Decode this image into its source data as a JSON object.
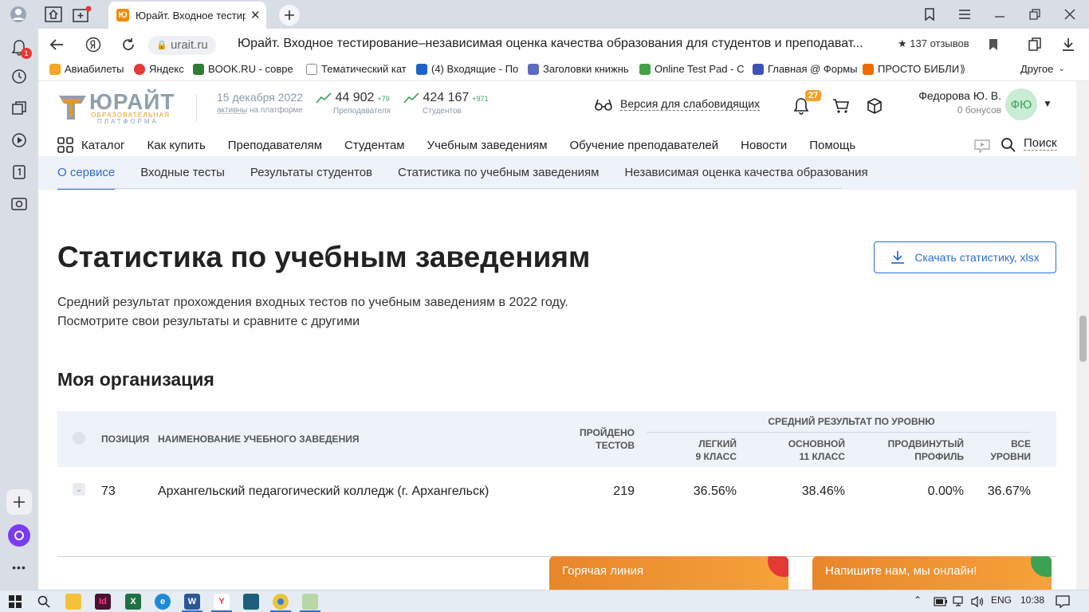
{
  "browser": {
    "tab_title": "Юрайт. Входное тестир",
    "url_host": "urait.ru",
    "page_title": "Юрайт. Входное тестирование–независимая оценка качества образования для студентов и преподават...",
    "reviews": "★ 137 отзывов",
    "notif_count": "1",
    "bookmarks": [
      {
        "label": "Авиабилеты",
        "color": "#f5a623"
      },
      {
        "label": "Яндекс",
        "color": "#e53935"
      },
      {
        "label": "BOOK.RU - совре",
        "color": "#2e7d32"
      },
      {
        "label": "Тематический кат",
        "color": "#9e9e9e"
      },
      {
        "label": "(4) Входящие - По",
        "color": "#1e63c4"
      },
      {
        "label": "Заголовки книжнь",
        "color": "#5c6bc0"
      },
      {
        "label": "Online Test Pad - С",
        "color": "#43a047"
      },
      {
        "label": "Главная @ Формы",
        "color": "#3f51b5"
      },
      {
        "label": "ПРОСТО БИБЛИ",
        "color": "#ef6c00"
      }
    ],
    "bookmarks_other": "Другое"
  },
  "site": {
    "logo": {
      "name": "ЮРАЙТ",
      "sub1": "ОБРАЗОВАТЕЛЬНАЯ",
      "sub2": "ПЛАТФОРМА"
    },
    "date": "15 декабря 2022",
    "date_sub_link": "активны",
    "date_sub_rest": " на платформе",
    "teachers": {
      "value": "44 902",
      "delta": "+79",
      "label": "Преподавателя"
    },
    "students": {
      "value": "424 167",
      "delta": "+971",
      "label": "Студентов"
    },
    "vision_label": "Версия для слабовидящих",
    "notifications": "27",
    "user": {
      "name": "Федорова Ю. В.",
      "bonus": "0 бонусов",
      "initials": "ФЮ"
    },
    "nav": [
      "Каталог",
      "Как купить",
      "Преподавателям",
      "Студентам",
      "Учебным заведениям",
      "Обучение преподавателей",
      "Новости",
      "Помощь"
    ],
    "search_label": "Поиск",
    "subnav": [
      "О сервисе",
      "Входные тесты",
      "Результаты студентов",
      "Статистика по учебным заведениям",
      "Независимая оценка качества образования"
    ]
  },
  "content": {
    "title": "Статистика по учебным заведениям",
    "download_label": "Скачать статистику, xlsx",
    "desc_line1": "Средний результат прохождения входных тестов по учебным заведениям в 2022 году.",
    "desc_line2": "Посмотрите свои результаты и сравните с другими",
    "section_title": "Моя организация",
    "table": {
      "col_position": "Позиция",
      "col_name": "Наименование учебного заведения",
      "col_tests_1": "Пройдено",
      "col_tests_2": "тестов",
      "group_header": "Средний результат по уровню",
      "col_easy_1": "Легкий",
      "col_easy_2": "9 класс",
      "col_basic_1": "Основной",
      "col_basic_2": "11 класс",
      "col_adv_1": "Продвинутый",
      "col_adv_2": "профиль",
      "col_all_1": "Все",
      "col_all_2": "уровни",
      "row": {
        "position": "73",
        "name": "Архангельский педагогический колледж (г. Архангельск)",
        "tests": "219",
        "easy": "36.56%",
        "basic": "38.46%",
        "advanced": "0.00%",
        "all": "36.67%"
      }
    },
    "hotline_label": "Горячая линия",
    "chat_label": "Напишите нам, мы онлайн!"
  },
  "taskbar": {
    "lang": "ENG",
    "time": "10:38"
  }
}
